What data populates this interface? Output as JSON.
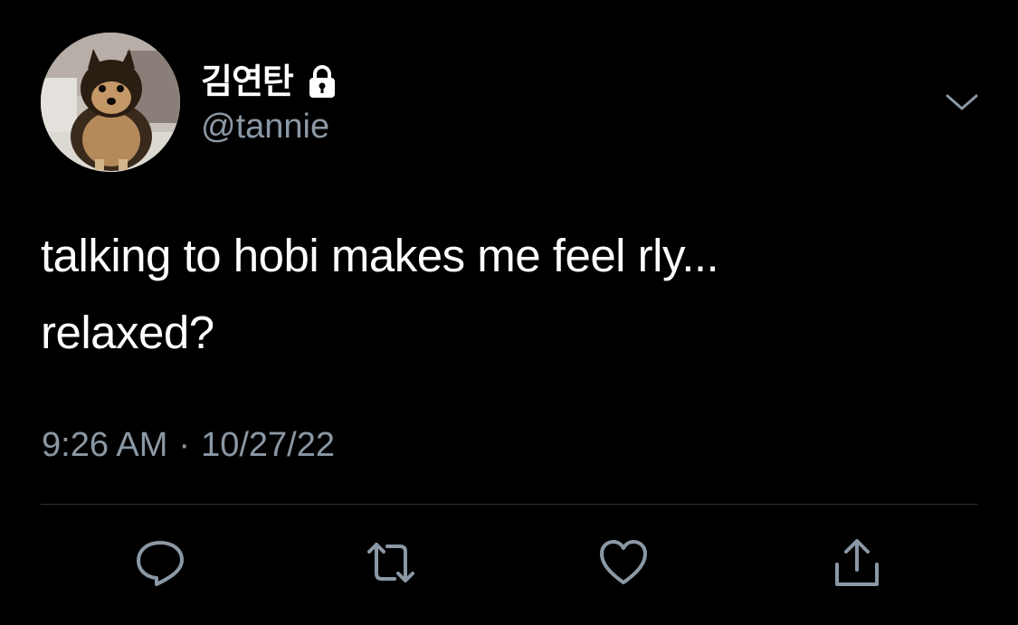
{
  "user": {
    "display_name": "김연탄",
    "handle": "@tannie",
    "protected_icon": "lock-icon",
    "avatar": "dog-avatar"
  },
  "tweet": {
    "text_line1": "talking to hobi makes me feel rly...",
    "text_line2": "relaxed?",
    "time": "9:26 AM",
    "separator": "·",
    "date": "10/27/22"
  },
  "actions": [
    {
      "name": "reply",
      "icon": "reply-icon"
    },
    {
      "name": "retweet",
      "icon": "retweet-icon"
    },
    {
      "name": "like",
      "icon": "heart-icon"
    },
    {
      "name": "share",
      "icon": "share-icon"
    }
  ],
  "colors": {
    "background": "#000000",
    "text": "#ffffff",
    "secondary": "#8b98a5",
    "divider": "#2f3336"
  }
}
